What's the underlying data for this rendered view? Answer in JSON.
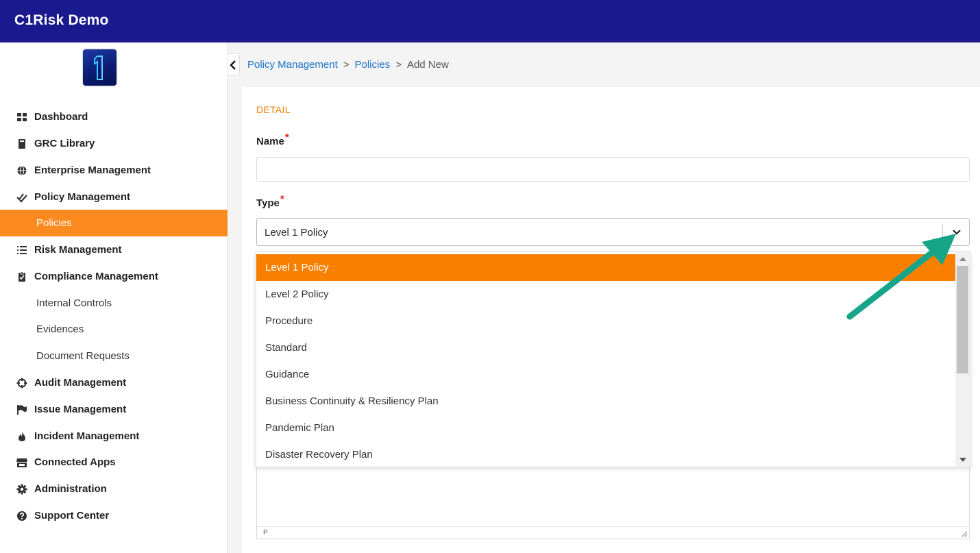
{
  "app": {
    "title": "C1Risk Demo"
  },
  "sidebar": {
    "items": [
      {
        "label": "Dashboard",
        "icon": "grid-icon"
      },
      {
        "label": "GRC Library",
        "icon": "book-icon"
      },
      {
        "label": "Enterprise Management",
        "icon": "globe-icon"
      },
      {
        "label": "Policy Management",
        "icon": "check-double-icon"
      },
      {
        "label": "Policies",
        "active": true
      },
      {
        "label": "Risk Management",
        "icon": "list-icon"
      },
      {
        "label": "Compliance Management",
        "icon": "clipboard-check-icon"
      },
      {
        "label": "Internal Controls"
      },
      {
        "label": "Evidences"
      },
      {
        "label": "Document Requests"
      },
      {
        "label": "Audit Management",
        "icon": "crosshairs-icon"
      },
      {
        "label": "Issue Management",
        "icon": "flag-icon"
      },
      {
        "label": "Incident Management",
        "icon": "fire-icon"
      },
      {
        "label": "Connected Apps",
        "icon": "store-icon"
      },
      {
        "label": "Administration",
        "icon": "cog-icon"
      },
      {
        "label": "Support Center",
        "icon": "question-circle-icon"
      }
    ]
  },
  "breadcrumb": {
    "level1": "Policy Management",
    "level2": "Policies",
    "current": "Add New",
    "separator": ">"
  },
  "form": {
    "section_title": "DETAIL",
    "name_label": "Name",
    "name_value": "",
    "type_label": "Type",
    "required_mark": "*",
    "type_value": "Level 1 Policy",
    "editor_status": "P"
  },
  "dropdown": {
    "options": [
      "Level 1 Policy",
      "Level 2 Policy",
      "Procedure",
      "Standard",
      "Guidance",
      "Business Continuity & Resiliency Plan",
      "Pandemic Plan",
      "Disaster Recovery Plan"
    ],
    "selected_index": 0
  },
  "colors": {
    "topbar": "#1a1a8e",
    "accent": "#fd8a1e",
    "link": "#1a73c8",
    "annotation_arrow": "#17a589",
    "required": "#e02020"
  }
}
